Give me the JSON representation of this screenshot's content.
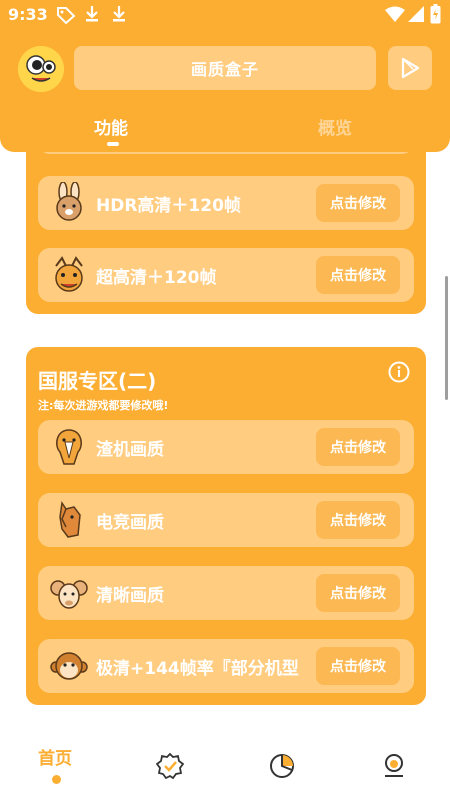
{
  "status": {
    "time": "9:33"
  },
  "header": {
    "title": "画质盒子"
  },
  "tabs": [
    {
      "label": "功能"
    },
    {
      "label": "概览"
    }
  ],
  "card1": {
    "rows": [
      {
        "label": "HDR高清＋120帧",
        "button": "点击修改",
        "icon": "rabbit-icon"
      },
      {
        "label": "超高清＋120帧",
        "button": "点击修改",
        "icon": "dragon-icon"
      }
    ]
  },
  "card2": {
    "title": "国服专区(二)",
    "note": "注:每次进游戏都要修改哦!",
    "rows": [
      {
        "label": "渣机画质",
        "button": "点击修改",
        "icon": "snake-icon"
      },
      {
        "label": "电竞画质",
        "button": "点击修改",
        "icon": "horse-icon"
      },
      {
        "label": "清晰画质",
        "button": "点击修改",
        "icon": "ram-icon"
      },
      {
        "label": "极清+144帧率『部分机型",
        "button": "点击修改",
        "icon": "monkey-icon"
      }
    ]
  },
  "nav": {
    "home": "首页"
  },
  "colors": {
    "accent": "#fcae33",
    "light": "#ffcc80",
    "button": "#fcb853"
  }
}
